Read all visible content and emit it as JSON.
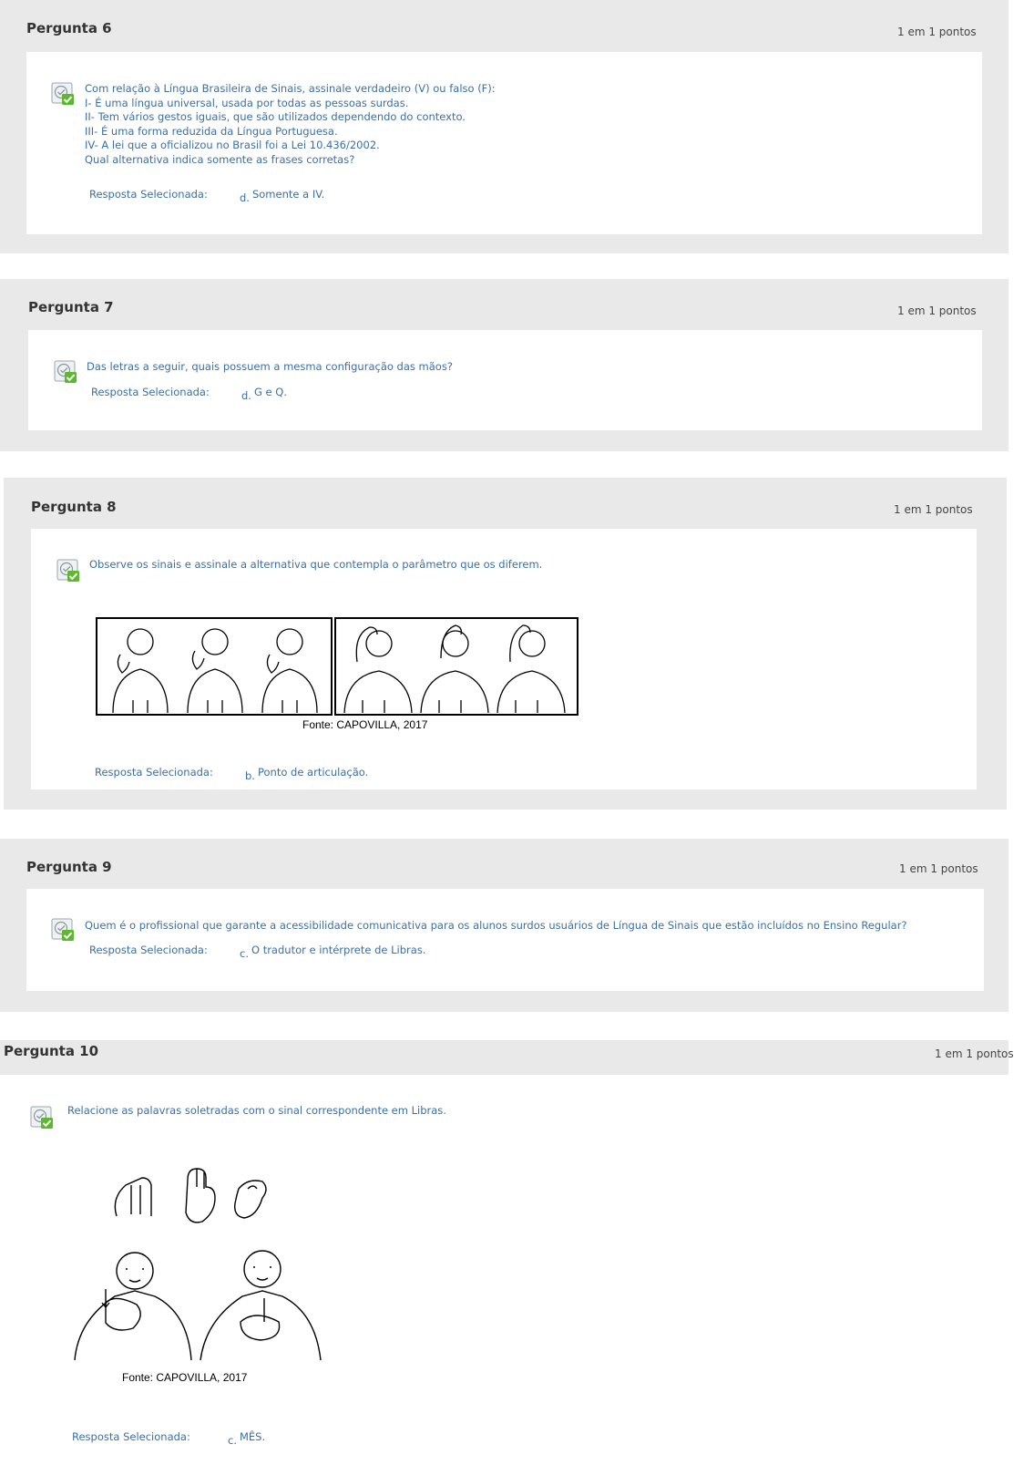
{
  "questions": [
    {
      "title": "Pergunta 6",
      "points": "1 em 1 pontos",
      "lines": [
        "Com relação à Língua Brasileira de Sinais, assinale verdadeiro (V) ou falso (F):",
        "I- É uma língua universal, usada por todas as pessoas surdas.",
        "II- Tem vários gestos iguais, que são utilizados dependendo do contexto.",
        "III- É uma forma reduzida da Língua Portuguesa.",
        "IV- A lei que a oficializou no Brasil foi a Lei 10.436/2002.",
        "Qual alternativa indica somente as frases corretas?"
      ],
      "answer_label": "Resposta Selecionada:",
      "answer_letter": "d.",
      "answer_text": "Somente a IV."
    },
    {
      "title": "Pergunta 7",
      "points": "1 em 1 pontos",
      "lines": [
        "Das letras a seguir, quais possuem a mesma configuração das mãos?"
      ],
      "answer_label": "Resposta Selecionada:",
      "answer_letter": "d.",
      "answer_text": "G e Q."
    },
    {
      "title": "Pergunta 8",
      "points": "1 em 1 pontos",
      "lines": [
        "Observe os sinais e assinale a alternativa que contempla o parâmetro que os diferem."
      ],
      "figure_caption": "Fonte: CAPOVILLA, 2017",
      "answer_label": "Resposta Selecionada:",
      "answer_letter": "b.",
      "answer_text": "Ponto de articulação."
    },
    {
      "title": "Pergunta 9",
      "points": "1 em 1 pontos",
      "lines": [
        "Quem é o profissional que garante a acessibilidade comunicativa para os alunos surdos usuários de Língua de Sinais que estão incluídos no Ensino Regular?"
      ],
      "answer_label": "Resposta Selecionada:",
      "answer_letter": "c.",
      "answer_text": "O tradutor e intérprete de Libras."
    },
    {
      "title": "Pergunta 10",
      "points": "1 em 1 pontos",
      "lines": [
        "Relacione as palavras soletradas com o sinal correspondente em Libras."
      ],
      "figure_caption": "Fonte: CAPOVILLA, 2017",
      "answer_label": "Resposta Selecionada:",
      "answer_letter": "c.",
      "answer_text": "MÊS."
    }
  ],
  "icon": "correct-answer-checkmark-icon",
  "colors": {
    "panel": "#e9e9e9",
    "text_link": "#3b6fa6",
    "check": "#5cb82e"
  }
}
